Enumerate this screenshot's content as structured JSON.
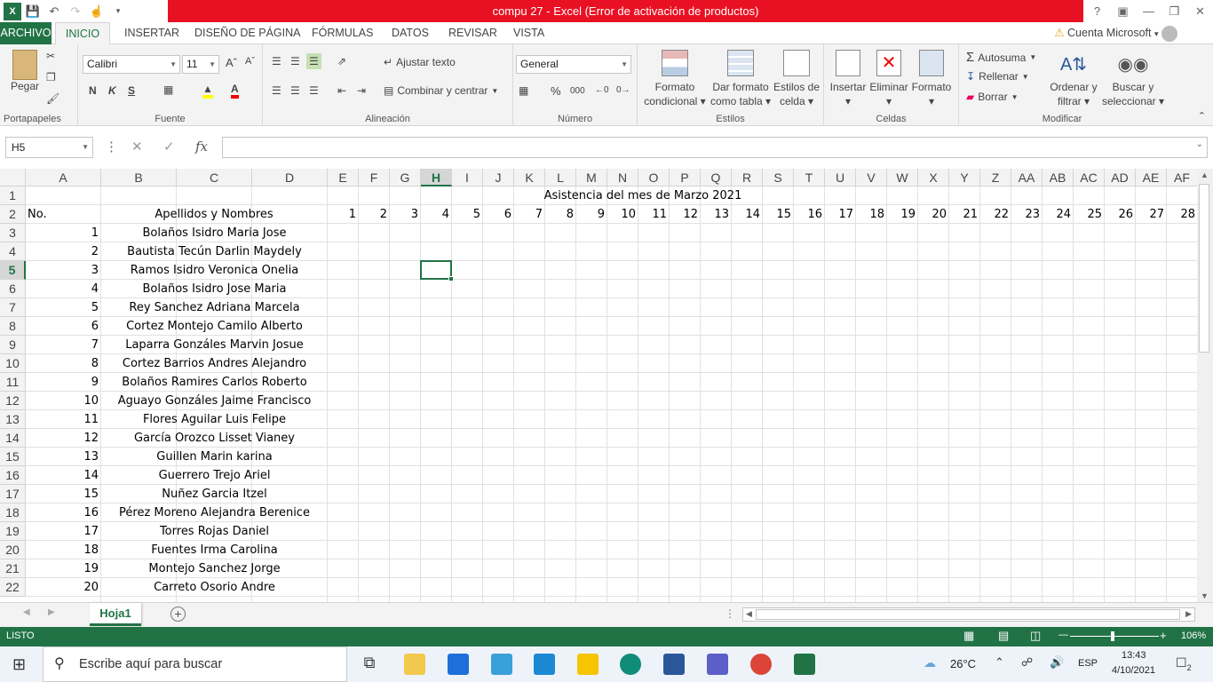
{
  "app": {
    "title": "compu 27 -  Excel (Error de activación de productos)",
    "account": "Cuenta Microsoft",
    "help": "?"
  },
  "menu": {
    "tabs": [
      "ARCHIVO",
      "INICIO",
      "INSERTAR",
      "DISEÑO DE PÁGINA",
      "FÓRMULAS",
      "DATOS",
      "REVISAR",
      "VISTA"
    ]
  },
  "ribbon": {
    "clipboard": {
      "paste": "Pegar",
      "label": "Portapapeles"
    },
    "font": {
      "name": "Calibri",
      "size": "11",
      "bold": "N",
      "italic": "K",
      "underline": "S",
      "label": "Fuente"
    },
    "alignment": {
      "wrap": "Ajustar texto",
      "merge": "Combinar y centrar",
      "label": "Alineación"
    },
    "number": {
      "format": "General",
      "percent": "%",
      "thousands": "000",
      "label": "Número"
    },
    "styles": {
      "cond1": "Formato",
      "cond2": "condicional",
      "table1": "Dar formato",
      "table2": "como tabla",
      "cell1": "Estilos de",
      "cell2": "celda",
      "label": "Estilos"
    },
    "cells": {
      "insert": "Insertar",
      "delete": "Eliminar",
      "format": "Formato",
      "label": "Celdas"
    },
    "editing": {
      "autosum": "Autosuma",
      "fill": "Rellenar",
      "clear": "Borrar",
      "sort1": "Ordenar y",
      "sort2": "filtrar",
      "find1": "Buscar y",
      "find2": "seleccionar",
      "label": "Modificar"
    }
  },
  "formula": {
    "namebox": "H5",
    "fx": "fx",
    "value": ""
  },
  "sheet": {
    "columns": [
      "A",
      "B",
      "C",
      "D",
      "E",
      "F",
      "G",
      "H",
      "I",
      "J",
      "K",
      "L",
      "M",
      "N",
      "O",
      "P",
      "Q",
      "R",
      "S",
      "T",
      "U",
      "V",
      "W",
      "X",
      "Y",
      "Z",
      "AA",
      "AB",
      "AC",
      "AD",
      "AE",
      "AF"
    ],
    "rows": [
      "1",
      "2",
      "3",
      "4",
      "5",
      "6",
      "7",
      "8",
      "9",
      "10",
      "11",
      "12",
      "13",
      "14",
      "15",
      "16",
      "17",
      "18",
      "19",
      "20",
      "21",
      "22"
    ],
    "selected_cell": "H5",
    "title": "Asistencia del mes de Marzo 2021",
    "header_no": "No.",
    "header_names": "Apellidos y Nombres",
    "days": [
      "1",
      "2",
      "3",
      "4",
      "5",
      "6",
      "7",
      "8",
      "9",
      "10",
      "11",
      "12",
      "13",
      "14",
      "15",
      "16",
      "17",
      "18",
      "19",
      "20",
      "21",
      "22",
      "23",
      "24",
      "25",
      "26",
      "27",
      "28"
    ],
    "students": [
      {
        "no": "1",
        "name": "Bolaños Isidro Maria Jose"
      },
      {
        "no": "2",
        "name": "Bautista Tecún Darlin Maydely"
      },
      {
        "no": "3",
        "name": "Ramos Isidro Veronica Onelia"
      },
      {
        "no": "4",
        "name": "Bolaños Isidro Jose Maria"
      },
      {
        "no": "5",
        "name": "Rey Sanchez Adriana Marcela"
      },
      {
        "no": "6",
        "name": "Cortez Montejo Camilo Alberto"
      },
      {
        "no": "7",
        "name": "Laparra Gonzáles Marvin Josue"
      },
      {
        "no": "8",
        "name": "Cortez Barrios Andres Alejandro"
      },
      {
        "no": "9",
        "name": "Bolaños Ramires Carlos Roberto"
      },
      {
        "no": "10",
        "name": "Aguayo Gonzáles Jaime Francisco"
      },
      {
        "no": "11",
        "name": "Flores Aguilar Luis Felipe"
      },
      {
        "no": "12",
        "name": "García Orozco Lisset Vianey"
      },
      {
        "no": "13",
        "name": "Guillen Marin karina"
      },
      {
        "no": "14",
        "name": "Guerrero Trejo Ariel"
      },
      {
        "no": "15",
        "name": "Nuñez Garcia Itzel"
      },
      {
        "no": "16",
        "name": "Pérez Moreno Alejandra Berenice"
      },
      {
        "no": "17",
        "name": "Torres Rojas Daniel"
      },
      {
        "no": "18",
        "name": "Fuentes Irma Carolina"
      },
      {
        "no": "19",
        "name": "Montejo Sanchez Jorge"
      },
      {
        "no": "20",
        "name": "Carreto Osorio Andre"
      }
    ],
    "tab": "Hoja1"
  },
  "status": {
    "mode": "LISTO",
    "zoom": "106%"
  },
  "taskbar": {
    "search": "Escribe aquí para buscar",
    "temp": "26°C",
    "lang": "ESP",
    "time": "13:43",
    "date": "4/10/2021",
    "notif": "2"
  },
  "colors": {
    "accent": "#217346",
    "error": "#e81123"
  }
}
